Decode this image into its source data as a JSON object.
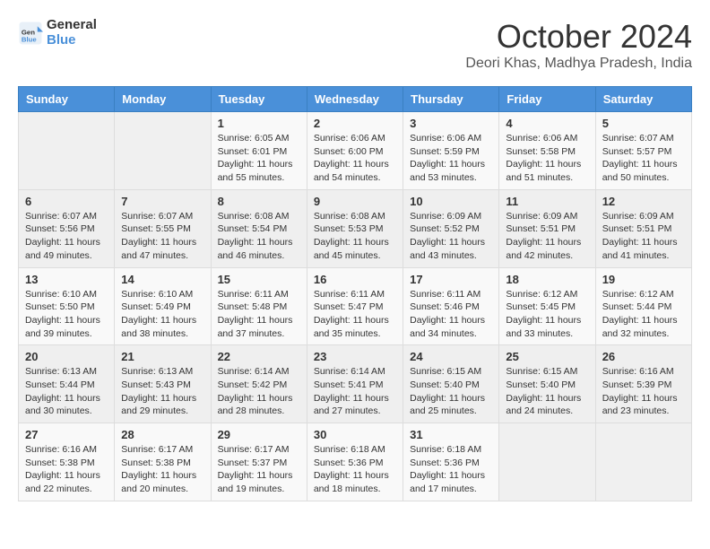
{
  "header": {
    "logo_line1": "General",
    "logo_line2": "Blue",
    "month": "October 2024",
    "location": "Deori Khas, Madhya Pradesh, India"
  },
  "weekdays": [
    "Sunday",
    "Monday",
    "Tuesday",
    "Wednesday",
    "Thursday",
    "Friday",
    "Saturday"
  ],
  "weeks": [
    [
      {
        "day": "",
        "info": ""
      },
      {
        "day": "",
        "info": ""
      },
      {
        "day": "1",
        "info": "Sunrise: 6:05 AM\nSunset: 6:01 PM\nDaylight: 11 hours and 55 minutes."
      },
      {
        "day": "2",
        "info": "Sunrise: 6:06 AM\nSunset: 6:00 PM\nDaylight: 11 hours and 54 minutes."
      },
      {
        "day": "3",
        "info": "Sunrise: 6:06 AM\nSunset: 5:59 PM\nDaylight: 11 hours and 53 minutes."
      },
      {
        "day": "4",
        "info": "Sunrise: 6:06 AM\nSunset: 5:58 PM\nDaylight: 11 hours and 51 minutes."
      },
      {
        "day": "5",
        "info": "Sunrise: 6:07 AM\nSunset: 5:57 PM\nDaylight: 11 hours and 50 minutes."
      }
    ],
    [
      {
        "day": "6",
        "info": "Sunrise: 6:07 AM\nSunset: 5:56 PM\nDaylight: 11 hours and 49 minutes."
      },
      {
        "day": "7",
        "info": "Sunrise: 6:07 AM\nSunset: 5:55 PM\nDaylight: 11 hours and 47 minutes."
      },
      {
        "day": "8",
        "info": "Sunrise: 6:08 AM\nSunset: 5:54 PM\nDaylight: 11 hours and 46 minutes."
      },
      {
        "day": "9",
        "info": "Sunrise: 6:08 AM\nSunset: 5:53 PM\nDaylight: 11 hours and 45 minutes."
      },
      {
        "day": "10",
        "info": "Sunrise: 6:09 AM\nSunset: 5:52 PM\nDaylight: 11 hours and 43 minutes."
      },
      {
        "day": "11",
        "info": "Sunrise: 6:09 AM\nSunset: 5:51 PM\nDaylight: 11 hours and 42 minutes."
      },
      {
        "day": "12",
        "info": "Sunrise: 6:09 AM\nSunset: 5:51 PM\nDaylight: 11 hours and 41 minutes."
      }
    ],
    [
      {
        "day": "13",
        "info": "Sunrise: 6:10 AM\nSunset: 5:50 PM\nDaylight: 11 hours and 39 minutes."
      },
      {
        "day": "14",
        "info": "Sunrise: 6:10 AM\nSunset: 5:49 PM\nDaylight: 11 hours and 38 minutes."
      },
      {
        "day": "15",
        "info": "Sunrise: 6:11 AM\nSunset: 5:48 PM\nDaylight: 11 hours and 37 minutes."
      },
      {
        "day": "16",
        "info": "Sunrise: 6:11 AM\nSunset: 5:47 PM\nDaylight: 11 hours and 35 minutes."
      },
      {
        "day": "17",
        "info": "Sunrise: 6:11 AM\nSunset: 5:46 PM\nDaylight: 11 hours and 34 minutes."
      },
      {
        "day": "18",
        "info": "Sunrise: 6:12 AM\nSunset: 5:45 PM\nDaylight: 11 hours and 33 minutes."
      },
      {
        "day": "19",
        "info": "Sunrise: 6:12 AM\nSunset: 5:44 PM\nDaylight: 11 hours and 32 minutes."
      }
    ],
    [
      {
        "day": "20",
        "info": "Sunrise: 6:13 AM\nSunset: 5:44 PM\nDaylight: 11 hours and 30 minutes."
      },
      {
        "day": "21",
        "info": "Sunrise: 6:13 AM\nSunset: 5:43 PM\nDaylight: 11 hours and 29 minutes."
      },
      {
        "day": "22",
        "info": "Sunrise: 6:14 AM\nSunset: 5:42 PM\nDaylight: 11 hours and 28 minutes."
      },
      {
        "day": "23",
        "info": "Sunrise: 6:14 AM\nSunset: 5:41 PM\nDaylight: 11 hours and 27 minutes."
      },
      {
        "day": "24",
        "info": "Sunrise: 6:15 AM\nSunset: 5:40 PM\nDaylight: 11 hours and 25 minutes."
      },
      {
        "day": "25",
        "info": "Sunrise: 6:15 AM\nSunset: 5:40 PM\nDaylight: 11 hours and 24 minutes."
      },
      {
        "day": "26",
        "info": "Sunrise: 6:16 AM\nSunset: 5:39 PM\nDaylight: 11 hours and 23 minutes."
      }
    ],
    [
      {
        "day": "27",
        "info": "Sunrise: 6:16 AM\nSunset: 5:38 PM\nDaylight: 11 hours and 22 minutes."
      },
      {
        "day": "28",
        "info": "Sunrise: 6:17 AM\nSunset: 5:38 PM\nDaylight: 11 hours and 20 minutes."
      },
      {
        "day": "29",
        "info": "Sunrise: 6:17 AM\nSunset: 5:37 PM\nDaylight: 11 hours and 19 minutes."
      },
      {
        "day": "30",
        "info": "Sunrise: 6:18 AM\nSunset: 5:36 PM\nDaylight: 11 hours and 18 minutes."
      },
      {
        "day": "31",
        "info": "Sunrise: 6:18 AM\nSunset: 5:36 PM\nDaylight: 11 hours and 17 minutes."
      },
      {
        "day": "",
        "info": ""
      },
      {
        "day": "",
        "info": ""
      }
    ]
  ]
}
